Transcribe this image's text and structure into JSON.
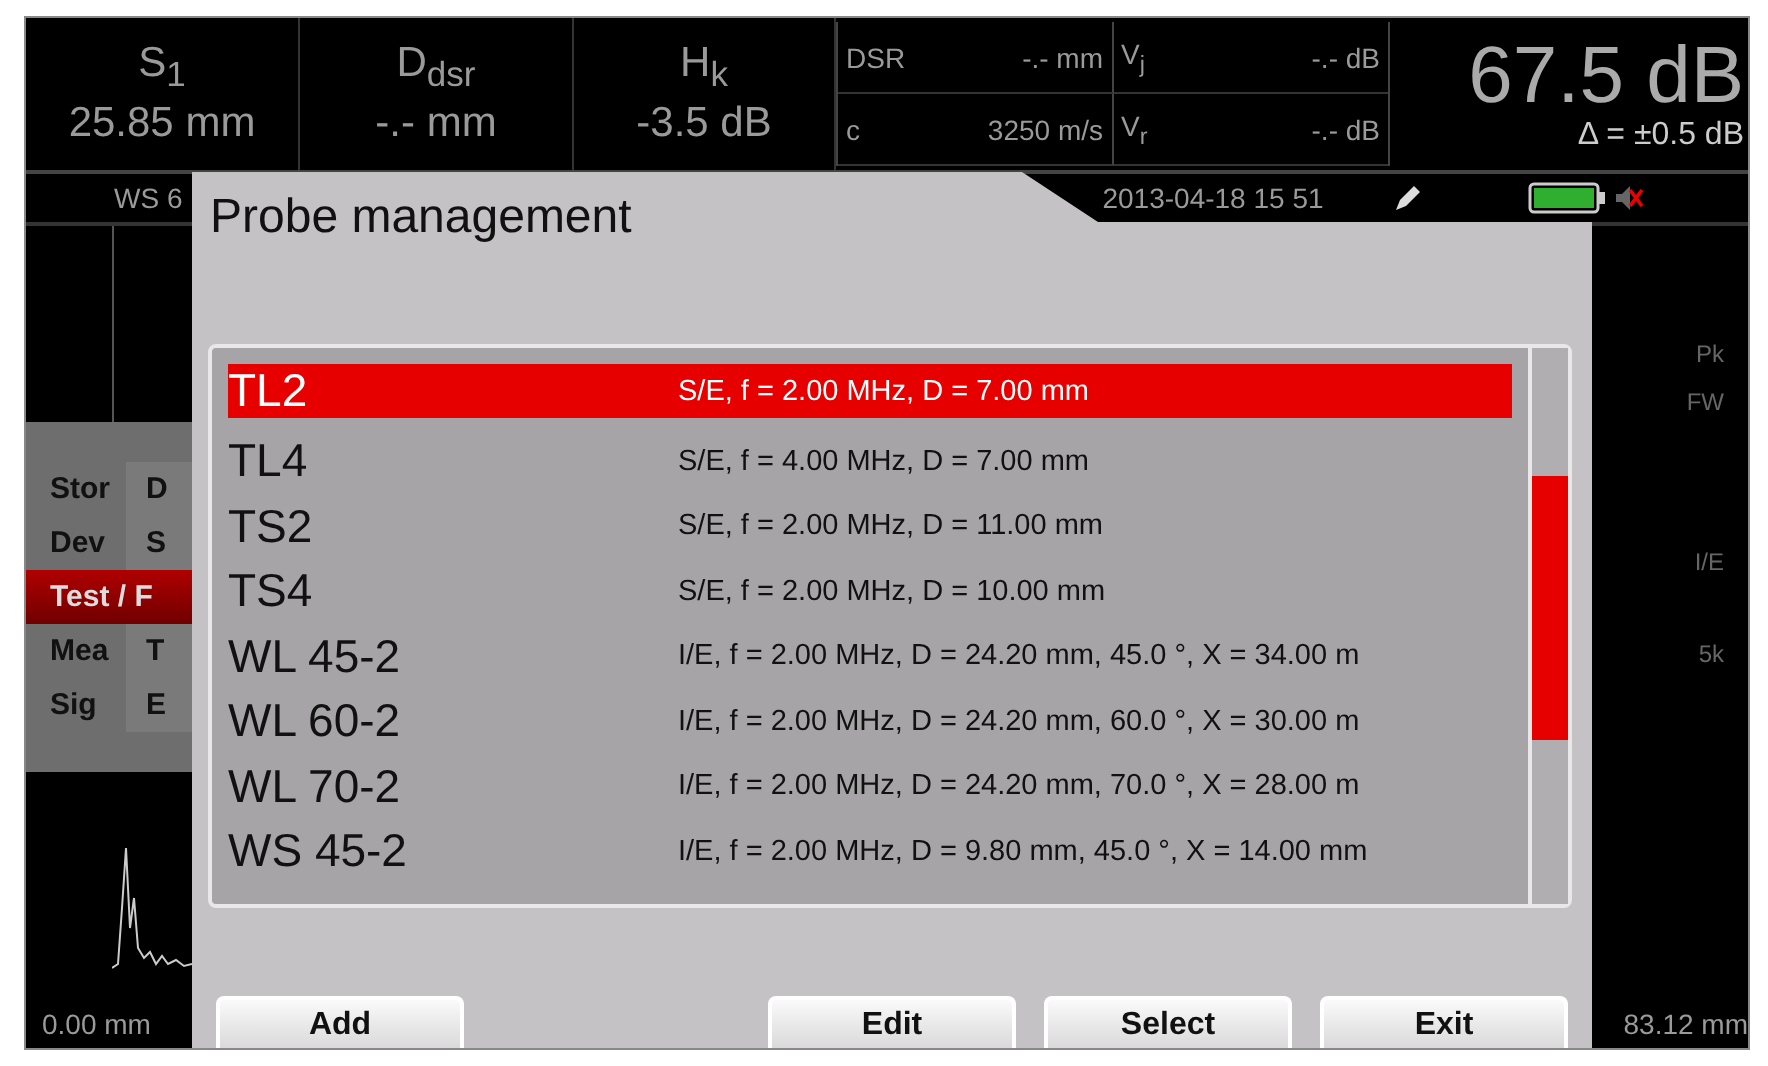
{
  "header": {
    "readings": [
      {
        "label": "S$_{1}$",
        "value": "25.85 mm"
      },
      {
        "label": "D$_{dsr}$",
        "value": "-.- mm"
      },
      {
        "label": "H$_{k}$",
        "value": "-3.5 dB"
      }
    ],
    "table": [
      {
        "label": "DSR",
        "value": "-.- mm"
      },
      {
        "label": "V$_{j}$",
        "value": "-.- dB"
      },
      {
        "label": "c",
        "value": "3250 m/s"
      },
      {
        "label": "V$_{r}$",
        "value": "-.- dB"
      }
    ],
    "gain": "67.5 dB",
    "delta": "Δ = ±0.5 dB"
  },
  "status": {
    "probe": "WS 6",
    "datetime": "2013-04-18 15 51",
    "muted": true
  },
  "menu": {
    "items": [
      {
        "label": "Stor",
        "sub": "D",
        "selected": false
      },
      {
        "label": "Dev",
        "sub": "S",
        "selected": false
      },
      {
        "label": "Test / F",
        "selected": true
      },
      {
        "label": "Mea",
        "sub": "T",
        "selected": false
      },
      {
        "label": "Sig",
        "sub": "E",
        "selected": false
      }
    ]
  },
  "scope": {
    "side_labels": [
      "Pk",
      "FW",
      "I/E",
      "5k"
    ],
    "x_start": "0.00 mm",
    "x_end": "83.12 mm"
  },
  "dialog": {
    "title": "Probe management",
    "probes": [
      {
        "name": "TL2",
        "description": "S/E, f = 2.00 MHz, D = 7.00 mm",
        "selected": true
      },
      {
        "name": "TL4",
        "description": "S/E, f = 4.00 MHz, D = 7.00 mm",
        "selected": false
      },
      {
        "name": "TS2",
        "description": "S/E, f = 2.00 MHz, D = 11.00 mm",
        "selected": false
      },
      {
        "name": "TS4",
        "description": "S/E, f = 2.00 MHz, D = 10.00 mm",
        "selected": false
      },
      {
        "name": "WL 45-2",
        "description": "I/E, f = 2.00 MHz, D = 24.20 mm, 45.0 °, X = 34.00 m",
        "selected": false
      },
      {
        "name": "WL 60-2",
        "description": "I/E, f = 2.00 MHz, D = 24.20 mm, 60.0 °, X = 30.00 m",
        "selected": false
      },
      {
        "name": "WL 70-2",
        "description": "I/E, f = 2.00 MHz, D = 24.20 mm, 70.0 °, X = 28.00 m",
        "selected": false
      },
      {
        "name": "WS 45-2",
        "description": "I/E, f = 2.00 MHz, D = 9.80 mm, 45.0 °, X = 14.00 mm",
        "selected": false
      }
    ],
    "buttons": [
      {
        "label": "Add",
        "kind": "left"
      },
      {
        "label": "Edit",
        "kind": "right"
      },
      {
        "label": "Select",
        "kind": "right"
      },
      {
        "label": "Exit",
        "kind": "right"
      }
    ]
  }
}
